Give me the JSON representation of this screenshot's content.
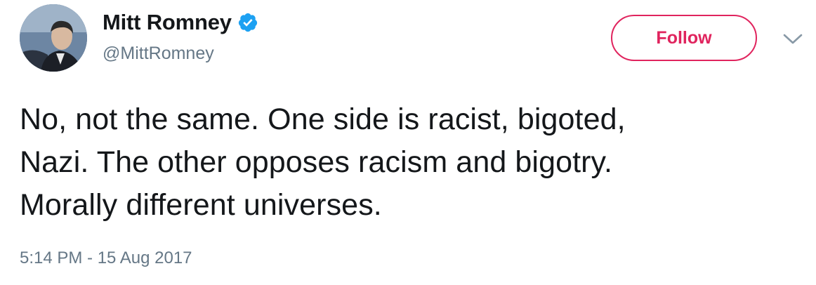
{
  "author": {
    "display_name": "Mitt Romney",
    "handle": "@MittRomney",
    "verified": true,
    "avatar_icon": "profile-photo"
  },
  "actions": {
    "follow_label": "Follow",
    "more_icon": "chevron-down-icon"
  },
  "tweet": {
    "lines": [
      "No, not the same. One side is racist, bigoted,",
      "Nazi. The other opposes racism and bigotry.",
      "Morally different universes."
    ],
    "timestamp": "5:14 PM - 15 Aug 2017"
  },
  "colors": {
    "follow_accent": "#e0245e",
    "verified_badge": "#1da1f2",
    "secondary_text": "#657786",
    "primary_text": "#14171a"
  }
}
